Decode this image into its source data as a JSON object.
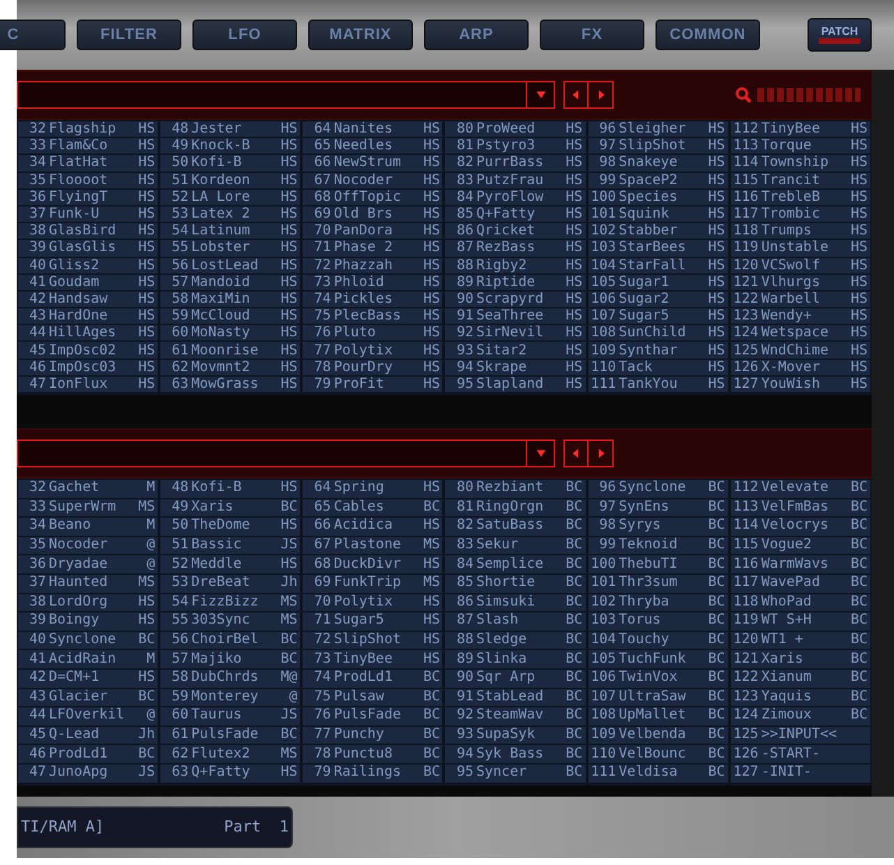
{
  "tabs": [
    {
      "label": "C"
    },
    {
      "label": "FILTER"
    },
    {
      "label": "LFO"
    },
    {
      "label": "MATRIX"
    },
    {
      "label": "ARP"
    },
    {
      "label": "FX"
    },
    {
      "label": "COMMON"
    }
  ],
  "patch_button": {
    "label": "PATCH"
  },
  "upper_browser": {
    "rows": [
      [
        {
          "number": "32",
          "name": "Flagship",
          "tag": "HS"
        },
        {
          "number": "48",
          "name": "Jester",
          "tag": "HS"
        },
        {
          "number": "64",
          "name": "Nanites",
          "tag": "HS"
        },
        {
          "number": "80",
          "name": "ProWeed",
          "tag": "HS"
        },
        {
          "number": "96",
          "name": "Sleigher",
          "tag": "HS"
        },
        {
          "number": "112",
          "name": "TinyBee",
          "tag": "HS"
        }
      ],
      [
        {
          "number": "33",
          "name": "Flam&Co",
          "tag": "HS"
        },
        {
          "number": "49",
          "name": "Knock-B",
          "tag": "HS"
        },
        {
          "number": "65",
          "name": "Needles",
          "tag": "HS"
        },
        {
          "number": "81",
          "name": "Pstyro3",
          "tag": "HS"
        },
        {
          "number": "97",
          "name": "SlipShot",
          "tag": "HS"
        },
        {
          "number": "113",
          "name": "Torque",
          "tag": "HS"
        }
      ],
      [
        {
          "number": "34",
          "name": "FlatHat",
          "tag": "HS"
        },
        {
          "number": "50",
          "name": "Kofi-B",
          "tag": "HS"
        },
        {
          "number": "66",
          "name": "NewStrum",
          "tag": "HS"
        },
        {
          "number": "82",
          "name": "PurrBass",
          "tag": "HS"
        },
        {
          "number": "98",
          "name": "Snakeye",
          "tag": "HS"
        },
        {
          "number": "114",
          "name": "Township",
          "tag": "HS"
        }
      ],
      [
        {
          "number": "35",
          "name": "Floooot",
          "tag": "HS"
        },
        {
          "number": "51",
          "name": "Kordeon",
          "tag": "HS"
        },
        {
          "number": "67",
          "name": "Nocoder",
          "tag": "HS"
        },
        {
          "number": "83",
          "name": "PutzFrau",
          "tag": "HS"
        },
        {
          "number": "99",
          "name": "SpaceP2",
          "tag": "HS"
        },
        {
          "number": "115",
          "name": "Trancit",
          "tag": "HS"
        }
      ],
      [
        {
          "number": "36",
          "name": "FlyingT",
          "tag": "HS"
        },
        {
          "number": "52",
          "name": "LA Lore",
          "tag": "HS"
        },
        {
          "number": "68",
          "name": "OffTopic",
          "tag": "HS"
        },
        {
          "number": "84",
          "name": "PyroFlow",
          "tag": "HS"
        },
        {
          "number": "100",
          "name": "Species",
          "tag": "HS"
        },
        {
          "number": "116",
          "name": "TrebleB",
          "tag": "HS"
        }
      ],
      [
        {
          "number": "37",
          "name": "Funk-U",
          "tag": "HS"
        },
        {
          "number": "53",
          "name": "Latex 2",
          "tag": "HS"
        },
        {
          "number": "69",
          "name": "Old Brs",
          "tag": "HS"
        },
        {
          "number": "85",
          "name": "Q+Fatty",
          "tag": "HS"
        },
        {
          "number": "101",
          "name": "Squink",
          "tag": "HS"
        },
        {
          "number": "117",
          "name": "Trombic",
          "tag": "HS"
        }
      ],
      [
        {
          "number": "38",
          "name": "GlasBird",
          "tag": "HS"
        },
        {
          "number": "54",
          "name": "Latinum",
          "tag": "HS"
        },
        {
          "number": "70",
          "name": "PanDora",
          "tag": "HS"
        },
        {
          "number": "86",
          "name": "Qricket",
          "tag": "HS"
        },
        {
          "number": "102",
          "name": "Stabber",
          "tag": "HS"
        },
        {
          "number": "118",
          "name": "Trumps",
          "tag": "HS"
        }
      ],
      [
        {
          "number": "39",
          "name": "GlasGlis",
          "tag": "HS"
        },
        {
          "number": "55",
          "name": "Lobster",
          "tag": "HS"
        },
        {
          "number": "71",
          "name": "Phase 2",
          "tag": "HS"
        },
        {
          "number": "87",
          "name": "RezBass",
          "tag": "HS"
        },
        {
          "number": "103",
          "name": "StarBees",
          "tag": "HS"
        },
        {
          "number": "119",
          "name": "Unstable",
          "tag": "HS"
        }
      ],
      [
        {
          "number": "40",
          "name": "Gliss2",
          "tag": "HS"
        },
        {
          "number": "56",
          "name": "LostLead",
          "tag": "HS"
        },
        {
          "number": "72",
          "name": "Phazzah",
          "tag": "HS"
        },
        {
          "number": "88",
          "name": "Rigby2",
          "tag": "HS"
        },
        {
          "number": "104",
          "name": "StarFall",
          "tag": "HS"
        },
        {
          "number": "120",
          "name": "VCSwolf",
          "tag": "HS"
        }
      ],
      [
        {
          "number": "41",
          "name": "Goudam",
          "tag": "HS"
        },
        {
          "number": "57",
          "name": "Mandoid",
          "tag": "HS"
        },
        {
          "number": "73",
          "name": "Phloid",
          "tag": "HS"
        },
        {
          "number": "89",
          "name": "Riptide",
          "tag": "HS"
        },
        {
          "number": "105",
          "name": "Sugar1",
          "tag": "HS"
        },
        {
          "number": "121",
          "name": "Vlhurgs",
          "tag": "HS"
        }
      ],
      [
        {
          "number": "42",
          "name": "Handsaw",
          "tag": "HS"
        },
        {
          "number": "58",
          "name": "MaxiMin",
          "tag": "HS"
        },
        {
          "number": "74",
          "name": "Pickles",
          "tag": "HS"
        },
        {
          "number": "90",
          "name": "Scrapyrd",
          "tag": "HS"
        },
        {
          "number": "106",
          "name": "Sugar2",
          "tag": "HS"
        },
        {
          "number": "122",
          "name": "Warbell",
          "tag": "HS"
        }
      ],
      [
        {
          "number": "43",
          "name": "HardOne",
          "tag": "HS"
        },
        {
          "number": "59",
          "name": "McCloud",
          "tag": "HS"
        },
        {
          "number": "75",
          "name": "PlecBass",
          "tag": "HS"
        },
        {
          "number": "91",
          "name": "SeaThree",
          "tag": "HS"
        },
        {
          "number": "107",
          "name": "Sugar5",
          "tag": "HS"
        },
        {
          "number": "123",
          "name": "Wendy+",
          "tag": "HS"
        }
      ],
      [
        {
          "number": "44",
          "name": "HillAges",
          "tag": "HS"
        },
        {
          "number": "60",
          "name": "MoNasty",
          "tag": "HS"
        },
        {
          "number": "76",
          "name": "Pluto",
          "tag": "HS"
        },
        {
          "number": "92",
          "name": "SirNevil",
          "tag": "HS"
        },
        {
          "number": "108",
          "name": "SunChild",
          "tag": "HS"
        },
        {
          "number": "124",
          "name": "Wetspace",
          "tag": "HS"
        }
      ],
      [
        {
          "number": "45",
          "name": "ImpOsc02",
          "tag": "HS"
        },
        {
          "number": "61",
          "name": "Moonrise",
          "tag": "HS"
        },
        {
          "number": "77",
          "name": "Polytix",
          "tag": "HS"
        },
        {
          "number": "93",
          "name": "Sitar2",
          "tag": "HS"
        },
        {
          "number": "109",
          "name": "Synthar",
          "tag": "HS"
        },
        {
          "number": "125",
          "name": "WndChime",
          "tag": "HS"
        }
      ],
      [
        {
          "number": "46",
          "name": "ImpOsc03",
          "tag": "HS"
        },
        {
          "number": "62",
          "name": "Movmnt2",
          "tag": "HS"
        },
        {
          "number": "78",
          "name": "PourDry",
          "tag": "HS"
        },
        {
          "number": "94",
          "name": "Skrape",
          "tag": "HS"
        },
        {
          "number": "110",
          "name": "Tack",
          "tag": "HS"
        },
        {
          "number": "126",
          "name": "X-Mover",
          "tag": "HS"
        }
      ],
      [
        {
          "number": "47",
          "name": "IonFlux",
          "tag": "HS"
        },
        {
          "number": "63",
          "name": "MowGrass",
          "tag": "HS"
        },
        {
          "number": "79",
          "name": "ProFit",
          "tag": "HS"
        },
        {
          "number": "95",
          "name": "Slapland",
          "tag": "HS"
        },
        {
          "number": "111",
          "name": "TankYou",
          "tag": "HS"
        },
        {
          "number": "127",
          "name": "YouWish",
          "tag": "HS"
        }
      ]
    ]
  },
  "lower_browser": {
    "rows": [
      [
        {
          "number": "32",
          "name": "Gachet",
          "tag": "M"
        },
        {
          "number": "48",
          "name": "Kofi-B",
          "tag": "HS"
        },
        {
          "number": "64",
          "name": "Spring",
          "tag": "HS"
        },
        {
          "number": "80",
          "name": "Rezbiant",
          "tag": "BC"
        },
        {
          "number": "96",
          "name": "Synclone",
          "tag": "BC"
        },
        {
          "number": "112",
          "name": "Velevate",
          "tag": "BC"
        }
      ],
      [
        {
          "number": "33",
          "name": "SuperWrm",
          "tag": "MS"
        },
        {
          "number": "49",
          "name": "Xaris",
          "tag": "BC"
        },
        {
          "number": "65",
          "name": "Cables",
          "tag": "BC"
        },
        {
          "number": "81",
          "name": "RingOrgn",
          "tag": "BC"
        },
        {
          "number": "97",
          "name": "SynEns",
          "tag": "BC"
        },
        {
          "number": "113",
          "name": "VelFmBas",
          "tag": "BC"
        }
      ],
      [
        {
          "number": "34",
          "name": "Beano",
          "tag": "M"
        },
        {
          "number": "50",
          "name": "TheDome",
          "tag": "HS"
        },
        {
          "number": "66",
          "name": "Acidica",
          "tag": "HS"
        },
        {
          "number": "82",
          "name": "SatuBass",
          "tag": "BC"
        },
        {
          "number": "98",
          "name": "Syrys",
          "tag": "BC"
        },
        {
          "number": "114",
          "name": "Velocrys",
          "tag": "BC"
        }
      ],
      [
        {
          "number": "35",
          "name": "Nocoder",
          "tag": "@"
        },
        {
          "number": "51",
          "name": "Bassic",
          "tag": "JS"
        },
        {
          "number": "67",
          "name": "Plastone",
          "tag": "MS"
        },
        {
          "number": "83",
          "name": "Sekur",
          "tag": "BC"
        },
        {
          "number": "99",
          "name": "Teknoid",
          "tag": "BC"
        },
        {
          "number": "115",
          "name": "Vogue2",
          "tag": "BC"
        }
      ],
      [
        {
          "number": "36",
          "name": "Dryadae",
          "tag": "@"
        },
        {
          "number": "52",
          "name": "Meddle",
          "tag": "HS"
        },
        {
          "number": "68",
          "name": "DuckDivr",
          "tag": "HS"
        },
        {
          "number": "84",
          "name": "Semplice",
          "tag": "BC"
        },
        {
          "number": "100",
          "name": "ThebuTI",
          "tag": "BC"
        },
        {
          "number": "116",
          "name": "WarmWavs",
          "tag": "BC"
        }
      ],
      [
        {
          "number": "37",
          "name": "Haunted",
          "tag": "MS"
        },
        {
          "number": "53",
          "name": "DreBeat",
          "tag": "Jh"
        },
        {
          "number": "69",
          "name": "FunkTrip",
          "tag": "MS"
        },
        {
          "number": "85",
          "name": "Shortie",
          "tag": "BC"
        },
        {
          "number": "101",
          "name": "Thr3sum",
          "tag": "BC"
        },
        {
          "number": "117",
          "name": "WavePad",
          "tag": "BC"
        }
      ],
      [
        {
          "number": "38",
          "name": "LordOrg",
          "tag": "HS"
        },
        {
          "number": "54",
          "name": "FizzBizz",
          "tag": "MS"
        },
        {
          "number": "70",
          "name": "Polytix",
          "tag": "HS"
        },
        {
          "number": "86",
          "name": "Simsuki",
          "tag": "BC"
        },
        {
          "number": "102",
          "name": "Thryba",
          "tag": "BC"
        },
        {
          "number": "118",
          "name": "WhoPad",
          "tag": "BC"
        }
      ],
      [
        {
          "number": "39",
          "name": "Boingy",
          "tag": "HS"
        },
        {
          "number": "55",
          "name": "303Sync",
          "tag": "MS"
        },
        {
          "number": "71",
          "name": "Sugar5",
          "tag": "HS"
        },
        {
          "number": "87",
          "name": "Slash",
          "tag": "BC"
        },
        {
          "number": "103",
          "name": "Torus",
          "tag": "BC"
        },
        {
          "number": "119",
          "name": "WT S+H",
          "tag": "BC"
        }
      ],
      [
        {
          "number": "40",
          "name": "Synclone",
          "tag": "BC"
        },
        {
          "number": "56",
          "name": "ChoirBel",
          "tag": "BC"
        },
        {
          "number": "72",
          "name": "SlipShot",
          "tag": "HS"
        },
        {
          "number": "88",
          "name": "Sledge",
          "tag": "BC"
        },
        {
          "number": "104",
          "name": "Touchy",
          "tag": "BC"
        },
        {
          "number": "120",
          "name": "WT1 +",
          "tag": "BC"
        }
      ],
      [
        {
          "number": "41",
          "name": "AcidRain",
          "tag": "M"
        },
        {
          "number": "57",
          "name": "Majiko",
          "tag": "BC"
        },
        {
          "number": "73",
          "name": "TinyBee",
          "tag": "HS"
        },
        {
          "number": "89",
          "name": "Slinka",
          "tag": "BC"
        },
        {
          "number": "105",
          "name": "TuchFunk",
          "tag": "BC"
        },
        {
          "number": "121",
          "name": "Xaris",
          "tag": "BC"
        }
      ],
      [
        {
          "number": "42",
          "name": "D=CM+1",
          "tag": "HS"
        },
        {
          "number": "58",
          "name": "DubChrds",
          "tag": "M@"
        },
        {
          "number": "74",
          "name": "ProdLd1",
          "tag": "BC"
        },
        {
          "number": "90",
          "name": "Sqr Arp",
          "tag": "BC"
        },
        {
          "number": "106",
          "name": "TwinVox",
          "tag": "BC"
        },
        {
          "number": "122",
          "name": "Xianum",
          "tag": "BC"
        }
      ],
      [
        {
          "number": "43",
          "name": "Glacier",
          "tag": "BC"
        },
        {
          "number": "59",
          "name": "Monterey",
          "tag": "@"
        },
        {
          "number": "75",
          "name": "Pulsaw",
          "tag": "BC"
        },
        {
          "number": "91",
          "name": "StabLead",
          "tag": "BC"
        },
        {
          "number": "107",
          "name": "UltraSaw",
          "tag": "BC"
        },
        {
          "number": "123",
          "name": "Yaquis",
          "tag": "BC"
        }
      ],
      [
        {
          "number": "44",
          "name": "LFOverkil",
          "tag": "@"
        },
        {
          "number": "60",
          "name": "Taurus",
          "tag": "JS"
        },
        {
          "number": "76",
          "name": "PulsFade",
          "tag": "BC"
        },
        {
          "number": "92",
          "name": "SteamWav",
          "tag": "BC"
        },
        {
          "number": "108",
          "name": "UpMallet",
          "tag": "BC"
        },
        {
          "number": "124",
          "name": "Zimoux",
          "tag": "BC"
        }
      ],
      [
        {
          "number": "45",
          "name": "Q-Lead",
          "tag": "Jh"
        },
        {
          "number": "61",
          "name": "PulsFade",
          "tag": "BC"
        },
        {
          "number": "77",
          "name": "Punchy",
          "tag": "BC"
        },
        {
          "number": "93",
          "name": "SupaSyk",
          "tag": "BC"
        },
        {
          "number": "109",
          "name": "Velbenda",
          "tag": "BC"
        },
        {
          "number": "125",
          "name": ">>INPUT<<"
        }
      ],
      [
        {
          "number": "46",
          "name": "ProdLd1",
          "tag": "BC"
        },
        {
          "number": "62",
          "name": "Flutex2",
          "tag": "MS"
        },
        {
          "number": "78",
          "name": "Punctu8",
          "tag": "BC"
        },
        {
          "number": "94",
          "name": "Syk Bass",
          "tag": "BC"
        },
        {
          "number": "110",
          "name": "VelBounc",
          "tag": "BC"
        },
        {
          "number": "126",
          "name": "-START-"
        }
      ],
      [
        {
          "number": "47",
          "name": "JunoApg",
          "tag": "JS"
        },
        {
          "number": "63",
          "name": "Q+Fatty",
          "tag": "HS"
        },
        {
          "number": "79",
          "name": "Railings",
          "tag": "BC"
        },
        {
          "number": "95",
          "name": "Syncer",
          "tag": "BC"
        },
        {
          "number": "111",
          "name": "Veldisa",
          "tag": "BC"
        },
        {
          "number": "127",
          "name": "-INIT-"
        }
      ]
    ]
  },
  "display": {
    "source": "TI/RAM A]",
    "part": "Part  1"
  }
}
